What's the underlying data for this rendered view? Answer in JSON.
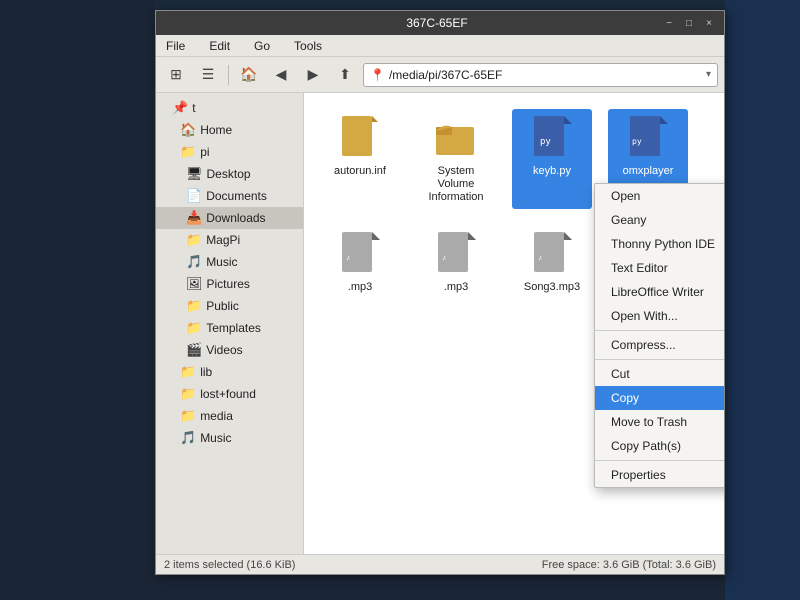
{
  "window": {
    "title": "367C-65EF",
    "titlebar_controls": [
      "−",
      "□",
      "×"
    ]
  },
  "menubar": {
    "items": [
      "File",
      "Edit",
      "Go",
      "Tools"
    ]
  },
  "toolbar": {
    "address": "/media/pi/367C-65EF"
  },
  "sidebar": {
    "items": [
      {
        "label": "t",
        "indent": 0,
        "icon": "📌"
      },
      {
        "label": "Home",
        "indent": 1,
        "icon": "🏠"
      },
      {
        "label": "pi",
        "indent": 1,
        "icon": "📁"
      },
      {
        "label": "Desktop",
        "indent": 2,
        "icon": "🖥"
      },
      {
        "label": "Documents",
        "indent": 2,
        "icon": "📄"
      },
      {
        "label": "Downloads",
        "indent": 2,
        "icon": "📥"
      },
      {
        "label": "MagPi",
        "indent": 2,
        "icon": "📁"
      },
      {
        "label": "Music",
        "indent": 2,
        "icon": "🎵"
      },
      {
        "label": "Pictures",
        "indent": 2,
        "icon": "🖼"
      },
      {
        "label": "Public",
        "indent": 2,
        "icon": "📁"
      },
      {
        "label": "Templates",
        "indent": 2,
        "icon": "📁"
      },
      {
        "label": "Videos",
        "indent": 2,
        "icon": "🎬"
      },
      {
        "label": "lib",
        "indent": 1,
        "icon": "📁"
      },
      {
        "label": "lost+found",
        "indent": 1,
        "icon": "📁"
      },
      {
        "label": "media",
        "indent": 1,
        "icon": "📁"
      },
      {
        "label": "Music",
        "indent": 1,
        "icon": "🎵"
      }
    ]
  },
  "files": [
    {
      "name": "autorun.inf",
      "type": "file",
      "selected": false
    },
    {
      "name": "System Volume Information",
      "type": "folder",
      "selected": false
    },
    {
      "name": "keyb.py",
      "type": "python",
      "selected": true
    },
    {
      "name": "omxplayer",
      "type": "python",
      "selected": true
    },
    {
      "name": ".mp3",
      "type": "music",
      "selected": false
    },
    {
      "name": ".mp3",
      "type": "music",
      "selected": false
    },
    {
      "name": "Song3.mp3",
      "type": "music",
      "selected": false
    }
  ],
  "context_menu": {
    "items": [
      {
        "label": "Open",
        "type": "item"
      },
      {
        "label": "Geany",
        "type": "item"
      },
      {
        "label": "Thonny Python IDE",
        "type": "item"
      },
      {
        "label": "Text Editor",
        "type": "item"
      },
      {
        "label": "LibreOffice Writer",
        "type": "item"
      },
      {
        "label": "Open With...",
        "type": "item"
      },
      {
        "type": "sep"
      },
      {
        "label": "Compress...",
        "type": "item"
      },
      {
        "type": "sep"
      },
      {
        "label": "Cut",
        "type": "item"
      },
      {
        "label": "Copy",
        "type": "item",
        "highlighted": true
      },
      {
        "label": "Move to Trash",
        "type": "item"
      },
      {
        "label": "Copy Path(s)",
        "type": "item"
      },
      {
        "type": "sep"
      },
      {
        "label": "Properties",
        "type": "item"
      }
    ]
  },
  "statusbar": {
    "left": "2 items selected (16.6 KiB)",
    "right": "Free space: 3.6 GiB (Total: 3.6 GiB)"
  }
}
